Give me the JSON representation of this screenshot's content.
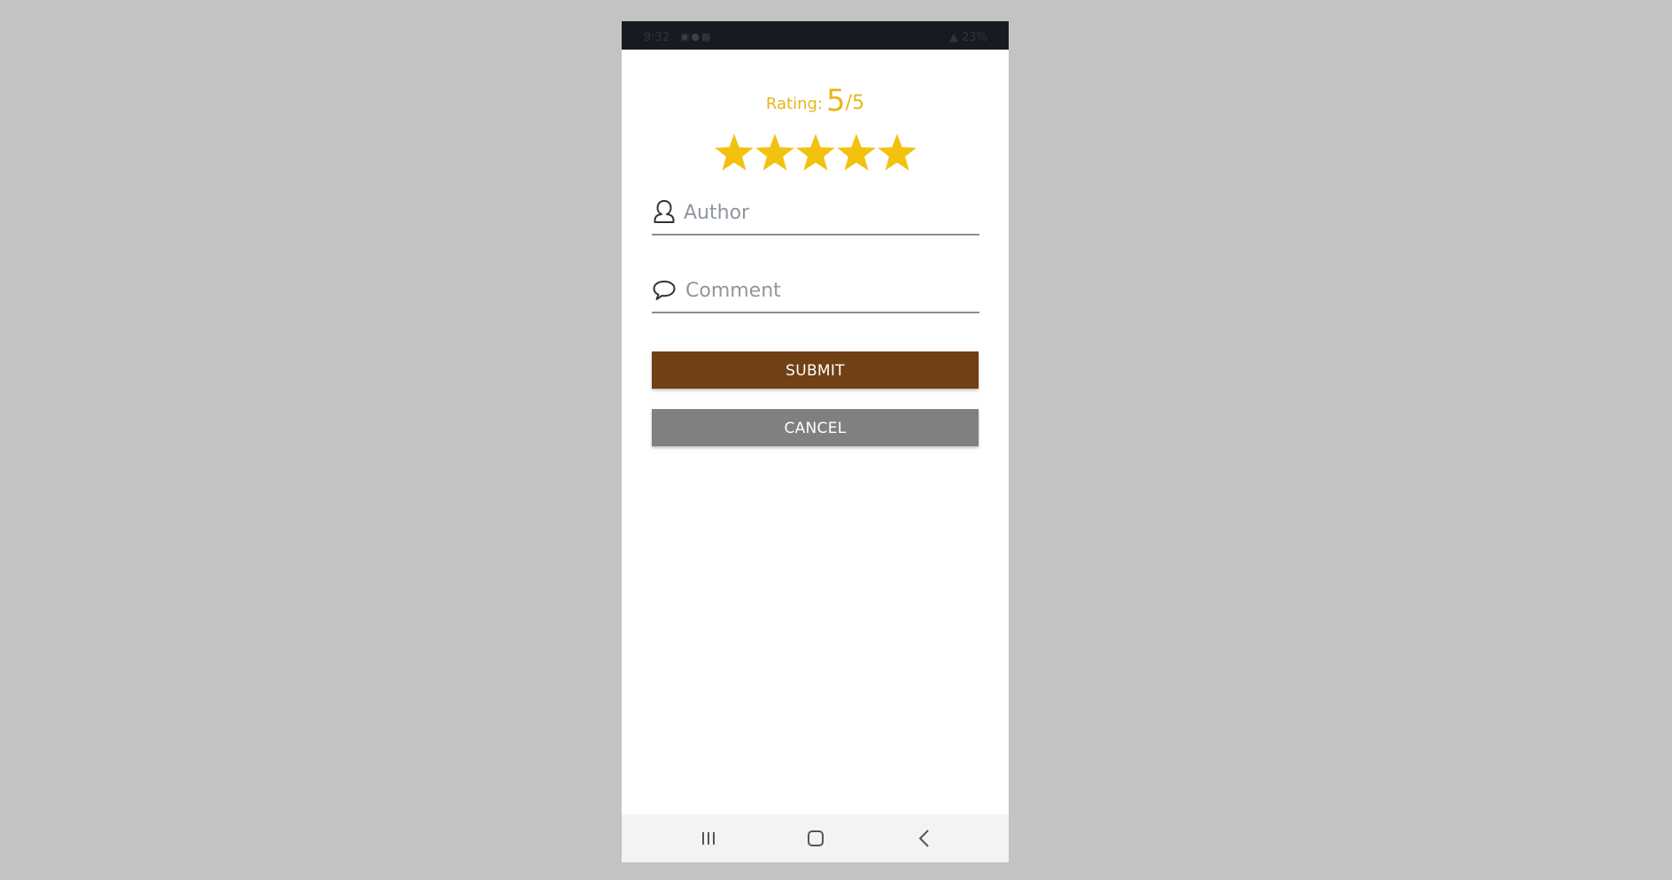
{
  "status_bar": {
    "time": "9:32",
    "left_icons": [
      "image-icon",
      "a-icon",
      "grid-icon"
    ],
    "battery": "23%"
  },
  "rating": {
    "label": "Rating:",
    "value": "5",
    "max": "/5",
    "stars_filled": 5,
    "stars_total": 5,
    "color": "#e8b718"
  },
  "form": {
    "author": {
      "placeholder": "Author",
      "value": "",
      "icon": "person-icon"
    },
    "comment": {
      "placeholder": "Comment",
      "value": "",
      "icon": "speech-bubble-icon"
    }
  },
  "buttons": {
    "submit_label": "SUBMIT",
    "submit_color": "#714015",
    "cancel_label": "CANCEL",
    "cancel_color": "#808080"
  },
  "nav_bar": {
    "icons": [
      "recents-icon",
      "home-icon",
      "back-icon"
    ]
  }
}
